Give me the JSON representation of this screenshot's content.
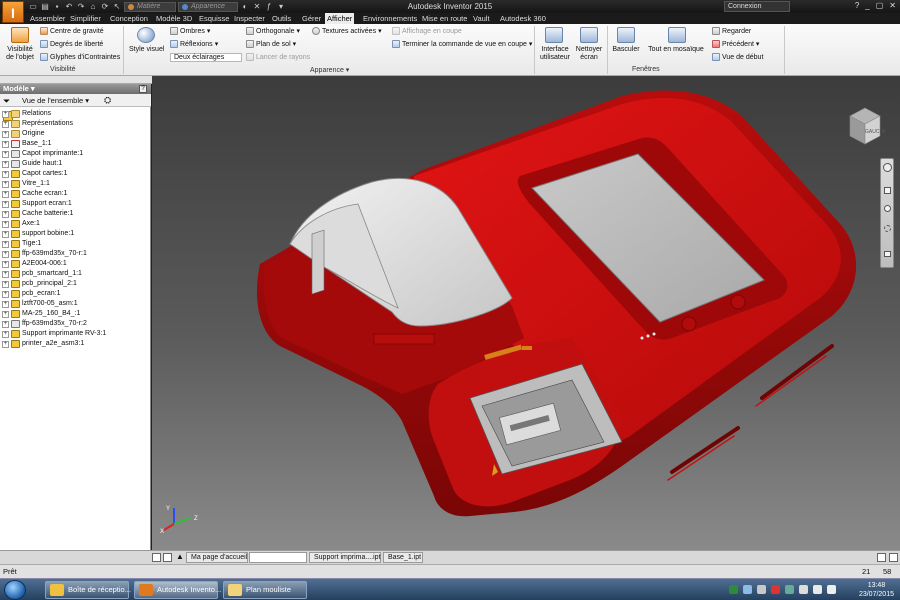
{
  "window": {
    "app_title": "Autodesk Inventor 2015",
    "signin": "Connexion",
    "material_placeholder": "Matière",
    "appearance_placeholder": "Apparence",
    "logo": "I"
  },
  "tabs": [
    "Assembler",
    "Simplifier",
    "Conception",
    "Modèle 3D",
    "Esquisse",
    "Inspecter",
    "Outils",
    "Gérer",
    "Afficher",
    "Environnements",
    "Mise en route",
    "Vault",
    "Autodesk 360"
  ],
  "active_tab": "Afficher",
  "ribbon": {
    "visibility": {
      "big_label_1": "Visibilité",
      "big_label_2": "de l'objet",
      "center_gravity": "Centre de gravité",
      "dof": "Degrés de liberté",
      "glyphs": "Glyphes d'iContraintes",
      "panel": "Visibilité"
    },
    "appearance": {
      "style_label": "Style visuel",
      "shadows": "Ombres",
      "reflections": "Réflexions",
      "lighting": "Deux éclairages",
      "ortho": "Orthogonale",
      "ground": "Plan de sol",
      "raytrace": "Lancer de rayons",
      "textures": "Textures activées",
      "section_display": "Affichage en coupe",
      "end_section": "Terminer la commande de vue en coupe",
      "panel": "Apparence"
    },
    "windows": {
      "ui_1": "Interface",
      "ui_2": "utilisateur",
      "clean_1": "Nettoyer",
      "clean_2": "écran",
      "switch": "Basculer",
      "tile": "Tout en mosaïque",
      "look": "Regarder",
      "previous": "Précédent",
      "home": "Vue de début",
      "panel": "Fenêtres"
    }
  },
  "browser": {
    "title": "Modèle",
    "help": "?",
    "view": "Vue de l'ensemble",
    "items": [
      {
        "label": "Relations",
        "icon": "folder"
      },
      {
        "label": "Représentations",
        "icon": "folder"
      },
      {
        "label": "Origine",
        "icon": "folder"
      },
      {
        "label": "Base_1:1",
        "icon": "grnd"
      },
      {
        "label": "Capot imprimante:1",
        "icon": "part"
      },
      {
        "label": "Guide haut:1",
        "icon": "part"
      },
      {
        "label": "Capot cartes:1",
        "icon": "asm"
      },
      {
        "label": "Vitre_1:1",
        "icon": "asm"
      },
      {
        "label": "Cache ecran:1",
        "icon": "asm"
      },
      {
        "label": "Support ecran:1",
        "icon": "asm"
      },
      {
        "label": "Cache batterie:1",
        "icon": "asm"
      },
      {
        "label": "Axe:1",
        "icon": "asm"
      },
      {
        "label": "support bobine:1",
        "icon": "asm"
      },
      {
        "label": "Tige:1",
        "icon": "asm"
      },
      {
        "label": "ffp-639md35x_70-r:1",
        "icon": "asm"
      },
      {
        "label": "A2E004-006:1",
        "icon": "asm"
      },
      {
        "label": "pcb_smartcard_1:1",
        "icon": "asm"
      },
      {
        "label": "pcb_principal_2:1",
        "icon": "asm"
      },
      {
        "label": "pcb_ecran:1",
        "icon": "asm"
      },
      {
        "label": "lztft700-05_asm:1",
        "icon": "asm"
      },
      {
        "label": "MA-25_160_B4_:1",
        "icon": "asm"
      },
      {
        "label": "ffp-639md35x_70-r:2",
        "icon": "part"
      },
      {
        "label": "Support imprimante RV-3:1",
        "icon": "asm"
      },
      {
        "label": "printer_a2e_asm3:1",
        "icon": "asm"
      }
    ]
  },
  "viewcube": {
    "face": "GAUCHE"
  },
  "doc_tabs": [
    "Ma page d'accueil",
    "",
    "Support imprima....ipt",
    "Base_1.ipt"
  ],
  "status": {
    "text": "Prêt",
    "n1": "21",
    "n2": "58"
  },
  "taskbar": {
    "items": [
      "Boîte de réceptio...",
      "Autodesk Invento...",
      "Plan mouliste"
    ],
    "time": "13:48",
    "date": "23/07/2015"
  },
  "colors": {
    "body": "#c80f0f",
    "accent": "#e5f0ff"
  }
}
